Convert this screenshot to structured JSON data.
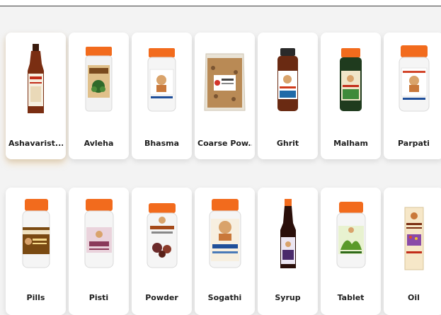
{
  "categories_row1": [
    {
      "label": "Ashavarist...",
      "icon": "bottle-tall-icon"
    },
    {
      "label": "Avleha",
      "icon": "jar-icon"
    },
    {
      "label": "Bhasma",
      "icon": "jar-icon"
    },
    {
      "label": "Coarse Pow...",
      "icon": "pouch-icon"
    },
    {
      "label": "Ghrit",
      "icon": "jar-icon"
    },
    {
      "label": "Malham",
      "icon": "jar-icon"
    },
    {
      "label": "Parpati",
      "icon": "jar-icon"
    }
  ],
  "categories_row2": [
    {
      "label": "Pills",
      "icon": "jar-icon"
    },
    {
      "label": "Pisti",
      "icon": "jar-icon"
    },
    {
      "label": "Powder",
      "icon": "jar-icon"
    },
    {
      "label": "Sogathi",
      "icon": "jar-icon"
    },
    {
      "label": "Syrup",
      "icon": "bottle-tall-icon"
    },
    {
      "label": "Tablet",
      "icon": "jar-icon"
    },
    {
      "label": "Oil",
      "icon": "box-icon"
    }
  ],
  "colors": {
    "cap_orange": "#f26b1d",
    "jar_white": "#f4f4f4",
    "bottle_brown": "#6b2a12",
    "bottle_dark": "#2b0f0a",
    "label_text": "#1f1f1f",
    "page_bg": "#f3f3f3"
  }
}
